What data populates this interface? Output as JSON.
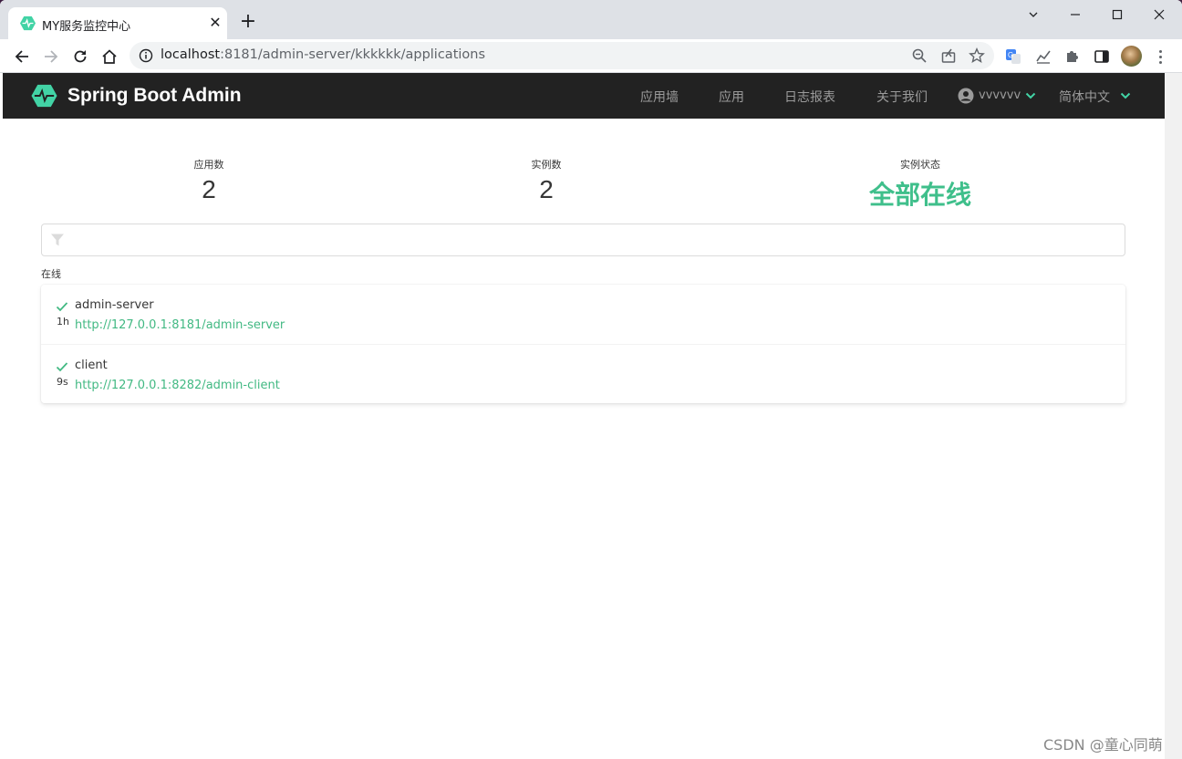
{
  "browser": {
    "tab_title": "MY服务监控中心",
    "tab_close": "✕",
    "new_tab": "+",
    "url_host": "localhost",
    "url_path": ":8181/admin-server/kkkkkk/applications"
  },
  "app": {
    "brand": "Spring Boot Admin",
    "nav": {
      "wallboard": "应用墙",
      "applications": "应用",
      "journal": "日志报表",
      "about": "关于我们",
      "user": "vvvvvv",
      "language": "简体中文"
    },
    "stats": {
      "apps_label": "应用数",
      "apps_value": "2",
      "instances_label": "实例数",
      "instances_value": "2",
      "status_label": "实例状态",
      "status_value": "全部在线"
    },
    "filter_placeholder": "",
    "group_label": "在线",
    "applications": [
      {
        "name": "admin-server",
        "age": "1h",
        "url": "http://127.0.0.1:8181/admin-server"
      },
      {
        "name": "client",
        "age": "9s",
        "url": "http://127.0.0.1:8282/admin-client"
      }
    ],
    "accent_color": "#42b983",
    "navbar_color": "#222222"
  },
  "watermark": "CSDN @童心同萌"
}
